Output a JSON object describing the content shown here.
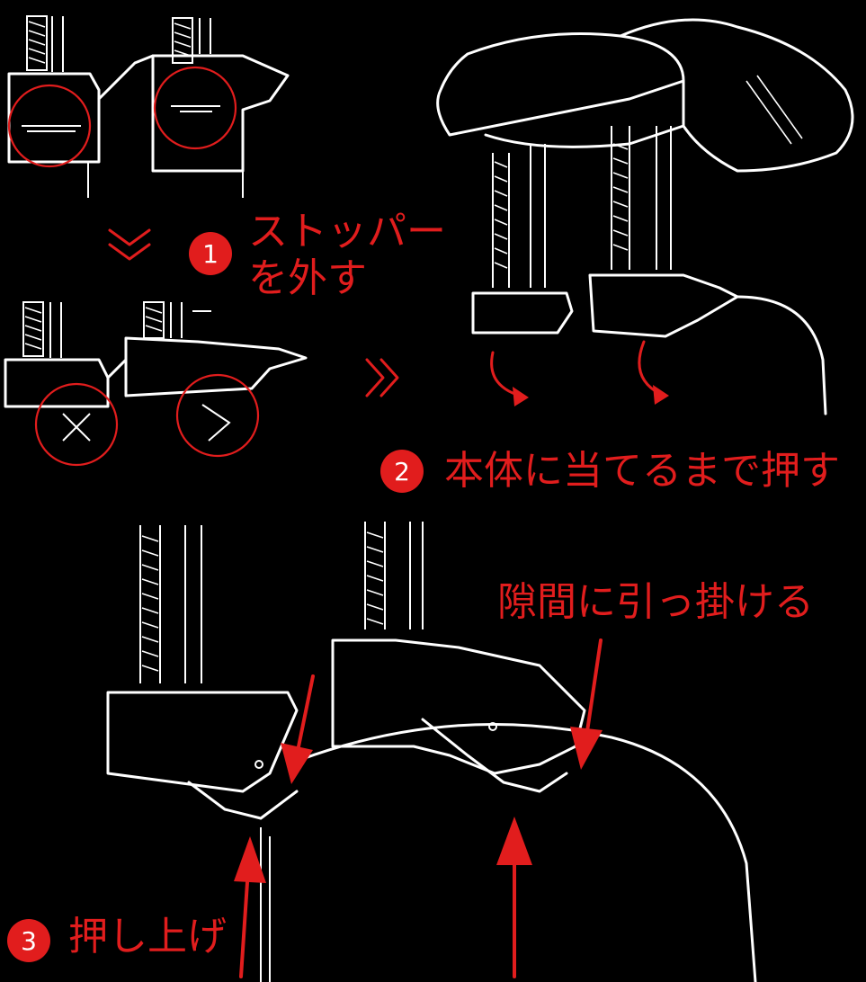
{
  "steps": [
    {
      "number": "1",
      "line1": "ストッパー",
      "line2": "を外す"
    },
    {
      "number": "2",
      "text": "本体に当てるまで押す"
    },
    {
      "number": "3",
      "text": "押し上げ"
    }
  ],
  "callout": "隙間に引っ掛ける",
  "colors": {
    "accent": "#e11d1d",
    "line": "#ffffff",
    "background": "#000000"
  },
  "icons": [
    "chevron-double-down-icon",
    "chevron-double-right-icon",
    "curved-arrow-icon",
    "arrow-up-icon",
    "arrow-down-icon"
  ]
}
